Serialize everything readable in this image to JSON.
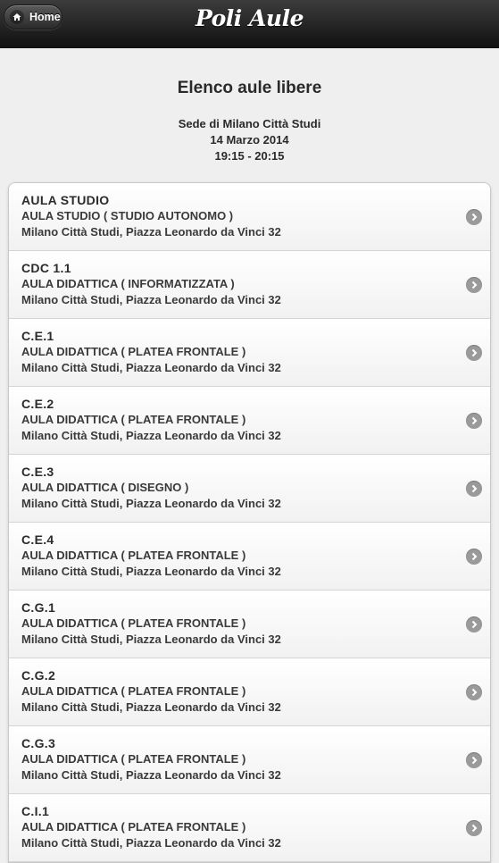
{
  "header": {
    "home_label": "Home",
    "app_title": "Poli Aule"
  },
  "page": {
    "heading": "Elenco aule libere",
    "sede": "Sede di Milano Città Studi",
    "date": "14 Marzo 2014",
    "time": "19:15 - 20:15"
  },
  "rooms": [
    {
      "name": "AULA STUDIO",
      "type": "AULA STUDIO ( STUDIO AUTONOMO )",
      "address": "Milano Città Studi, Piazza Leonardo da Vinci 32"
    },
    {
      "name": "CDC 1.1",
      "type": "AULA DIDATTICA ( INFORMATIZZATA )",
      "address": "Milano Città Studi, Piazza Leonardo da Vinci 32"
    },
    {
      "name": "C.E.1",
      "type": "AULA DIDATTICA ( PLATEA FRONTALE )",
      "address": "Milano Città Studi, Piazza Leonardo da Vinci 32"
    },
    {
      "name": "C.E.2",
      "type": "AULA DIDATTICA ( PLATEA FRONTALE )",
      "address": "Milano Città Studi, Piazza Leonardo da Vinci 32"
    },
    {
      "name": "C.E.3",
      "type": "AULA DIDATTICA ( DISEGNO )",
      "address": "Milano Città Studi, Piazza Leonardo da Vinci 32"
    },
    {
      "name": "C.E.4",
      "type": "AULA DIDATTICA ( PLATEA FRONTALE )",
      "address": "Milano Città Studi, Piazza Leonardo da Vinci 32"
    },
    {
      "name": "C.G.1",
      "type": "AULA DIDATTICA ( PLATEA FRONTALE )",
      "address": "Milano Città Studi, Piazza Leonardo da Vinci 32"
    },
    {
      "name": "C.G.2",
      "type": "AULA DIDATTICA ( PLATEA FRONTALE )",
      "address": "Milano Città Studi, Piazza Leonardo da Vinci 32"
    },
    {
      "name": "C.G.3",
      "type": "AULA DIDATTICA ( PLATEA FRONTALE )",
      "address": "Milano Città Studi, Piazza Leonardo da Vinci 32"
    },
    {
      "name": "C.I.1",
      "type": "AULA DIDATTICA ( PLATEA FRONTALE )",
      "address": "Milano Città Studi, Piazza Leonardo da Vinci 32"
    }
  ]
}
